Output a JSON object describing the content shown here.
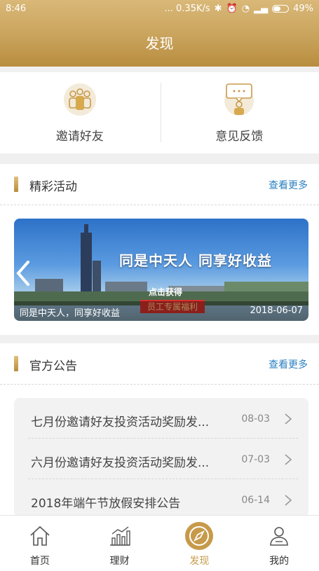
{
  "status_bar": {
    "time": "8:46",
    "network": "... 0.35K/s",
    "battery": "49%"
  },
  "header": {
    "title": "发现"
  },
  "quick_actions": [
    {
      "label": "邀请好友",
      "icon": "invite-friends-icon"
    },
    {
      "label": "意见反馈",
      "icon": "feedback-icon"
    }
  ],
  "activities": {
    "title": "精彩活动",
    "more": "查看更多",
    "banner": {
      "slogan": "同是中天人  同享好收益",
      "click_text": "点击获得",
      "badge": "员工专属福利",
      "caption": "同是中天人，同享好收益",
      "date": "2018-06-07"
    }
  },
  "announcements": {
    "title": "官方公告",
    "more": "查看更多",
    "items": [
      {
        "title": "七月份邀请好友投资活动奖励发...",
        "date": "08-03"
      },
      {
        "title": "六月份邀请好友投资活动奖励发...",
        "date": "07-03"
      },
      {
        "title": "2018年端午节放假安排公告",
        "date": "06-14"
      }
    ]
  },
  "tabs": [
    {
      "label": "首页",
      "icon": "home-icon"
    },
    {
      "label": "理财",
      "icon": "finance-chart-icon"
    },
    {
      "label": "发现",
      "icon": "compass-icon",
      "active": true
    },
    {
      "label": "我的",
      "icon": "user-icon"
    }
  ],
  "colors": {
    "accent": "#c79a4a",
    "link": "#2a7fc1"
  }
}
